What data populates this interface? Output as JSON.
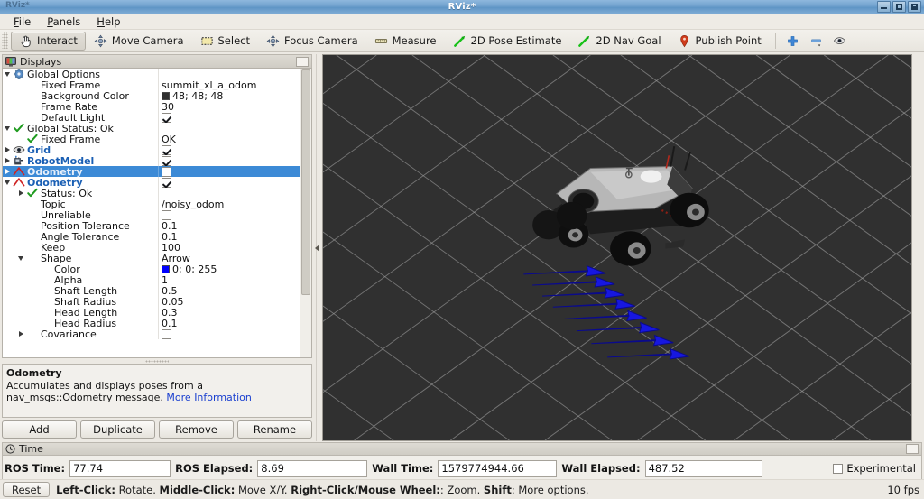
{
  "window": {
    "title": "RViz*",
    "controls": [
      "minimize",
      "maximize",
      "close"
    ]
  },
  "menubar": {
    "items": [
      {
        "label": "File",
        "mnemonic": "F"
      },
      {
        "label": "Panels",
        "mnemonic": "P"
      },
      {
        "label": "Help",
        "mnemonic": "H"
      }
    ]
  },
  "toolbar": {
    "tools": [
      {
        "label": "Interact",
        "icon": "hand-cursor-icon",
        "active": true
      },
      {
        "label": "Move Camera",
        "icon": "move-camera-icon",
        "active": false
      },
      {
        "label": "Select",
        "icon": "select-rect-icon",
        "active": false
      },
      {
        "label": "Focus Camera",
        "icon": "focus-camera-icon",
        "active": false
      },
      {
        "label": "Measure",
        "icon": "measure-icon",
        "active": false
      },
      {
        "label": "2D Pose Estimate",
        "icon": "pose-arrow-icon",
        "active": false
      },
      {
        "label": "2D Nav Goal",
        "icon": "nav-goal-arrow-icon",
        "active": false
      },
      {
        "label": "Publish Point",
        "icon": "map-pin-icon",
        "active": false
      }
    ],
    "right_buttons": [
      {
        "icon": "plus-icon",
        "label": "+"
      },
      {
        "icon": "minus-icon",
        "label": "−"
      },
      {
        "icon": "eye-icon",
        "label": "eye"
      }
    ]
  },
  "displays_panel": {
    "title": "Displays",
    "title_icon": "monitor-icon",
    "float_button": "undock-button",
    "rows": [
      {
        "indent": 0,
        "expander": "open",
        "icon": "gear-icon",
        "label": "Global Options",
        "style": "plain",
        "value_type": "none"
      },
      {
        "indent": 1,
        "expander": "none",
        "icon": "none",
        "label": "Fixed Frame",
        "style": "plain",
        "value_type": "text",
        "value": "summit_xl_a_odom"
      },
      {
        "indent": 1,
        "expander": "none",
        "icon": "none",
        "label": "Background Color",
        "style": "plain",
        "value_type": "color",
        "value": "48; 48; 48",
        "color": "#303030"
      },
      {
        "indent": 1,
        "expander": "none",
        "icon": "none",
        "label": "Frame Rate",
        "style": "plain",
        "value_type": "text",
        "value": "30"
      },
      {
        "indent": 1,
        "expander": "none",
        "icon": "none",
        "label": "Default Light",
        "style": "plain",
        "value_type": "checkbox",
        "checked": true
      },
      {
        "indent": 0,
        "expander": "open",
        "icon": "check-icon",
        "label": "Global Status: Ok",
        "style": "plain",
        "value_type": "none"
      },
      {
        "indent": 1,
        "expander": "none",
        "icon": "check-icon",
        "label": "Fixed Frame",
        "style": "plain",
        "value_type": "text",
        "value": "OK"
      },
      {
        "indent": 0,
        "expander": "closed",
        "icon": "eye-icon",
        "label": "Grid",
        "style": "blue",
        "value_type": "checkbox",
        "checked": true
      },
      {
        "indent": 0,
        "expander": "closed",
        "icon": "robot-icon",
        "label": "RobotModel",
        "style": "blue",
        "value_type": "checkbox",
        "checked": true
      },
      {
        "indent": 0,
        "expander": "closed",
        "icon": "odometry-icon",
        "label": "Odometry",
        "style": "blue",
        "value_type": "checkbox",
        "checked": false,
        "selected": true
      },
      {
        "indent": 0,
        "expander": "open",
        "icon": "odometry-icon",
        "label": "Odometry",
        "style": "blue",
        "value_type": "checkbox",
        "checked": true
      },
      {
        "indent": 1,
        "expander": "closed",
        "icon": "check-icon",
        "label": "Status: Ok",
        "style": "plain",
        "value_type": "none"
      },
      {
        "indent": 1,
        "expander": "none",
        "icon": "none",
        "label": "Topic",
        "style": "plain",
        "value_type": "text",
        "value": "/noisy_odom"
      },
      {
        "indent": 1,
        "expander": "none",
        "icon": "none",
        "label": "Unreliable",
        "style": "plain",
        "value_type": "checkbox",
        "checked": false
      },
      {
        "indent": 1,
        "expander": "none",
        "icon": "none",
        "label": "Position Tolerance",
        "style": "plain",
        "value_type": "text",
        "value": "0.1"
      },
      {
        "indent": 1,
        "expander": "none",
        "icon": "none",
        "label": "Angle Tolerance",
        "style": "plain",
        "value_type": "text",
        "value": "0.1"
      },
      {
        "indent": 1,
        "expander": "none",
        "icon": "none",
        "label": "Keep",
        "style": "plain",
        "value_type": "text",
        "value": "100"
      },
      {
        "indent": 1,
        "expander": "open",
        "icon": "none",
        "label": "Shape",
        "style": "plain",
        "value_type": "text",
        "value": "Arrow"
      },
      {
        "indent": 2,
        "expander": "none",
        "icon": "none",
        "label": "Color",
        "style": "plain",
        "value_type": "color",
        "value": "0; 0; 255",
        "color": "#0000ff"
      },
      {
        "indent": 2,
        "expander": "none",
        "icon": "none",
        "label": "Alpha",
        "style": "plain",
        "value_type": "text",
        "value": "1"
      },
      {
        "indent": 2,
        "expander": "none",
        "icon": "none",
        "label": "Shaft Length",
        "style": "plain",
        "value_type": "text",
        "value": "0.5"
      },
      {
        "indent": 2,
        "expander": "none",
        "icon": "none",
        "label": "Shaft Radius",
        "style": "plain",
        "value_type": "text",
        "value": "0.05"
      },
      {
        "indent": 2,
        "expander": "none",
        "icon": "none",
        "label": "Head Length",
        "style": "plain",
        "value_type": "text",
        "value": "0.3"
      },
      {
        "indent": 2,
        "expander": "none",
        "icon": "none",
        "label": "Head Radius",
        "style": "plain",
        "value_type": "text",
        "value": "0.1"
      },
      {
        "indent": 1,
        "expander": "closed",
        "icon": "none",
        "label": "Covariance",
        "style": "plain",
        "value_type": "checkbox",
        "checked": false
      }
    ]
  },
  "description": {
    "title": "Odometry",
    "text_line1": "Accumulates and displays poses from a",
    "text_line2": "nav_msgs::Odometry message.",
    "link": "More Information"
  },
  "display_buttons": [
    {
      "label": "Add"
    },
    {
      "label": "Duplicate"
    },
    {
      "label": "Remove"
    },
    {
      "label": "Rename"
    }
  ],
  "viewport": {
    "background_color": "#303030",
    "grid_color": "#9d9d9d",
    "collapse_arrow": "collapse-left-arrow",
    "robot": {
      "name": "summit_xl",
      "body_color": "#b9b9b9",
      "body_dark_color": "#2a2a2a",
      "wheel_color": "#141414",
      "arrow_color": "#1717e0",
      "arrow_count": 8
    }
  },
  "time_panel": {
    "title": "Time",
    "title_icon": "clock-icon",
    "float_button": "undock-button",
    "fields": [
      {
        "label": "ROS Time:",
        "value": "77.74"
      },
      {
        "label": "ROS Elapsed:",
        "value": "8.69"
      },
      {
        "label": "Wall Time:",
        "value": "1579774944.66"
      },
      {
        "label": "Wall Elapsed:",
        "value": "487.52"
      }
    ],
    "experimental": {
      "label": "Experimental",
      "checked": false
    }
  },
  "statusbar": {
    "reset_label": "Reset",
    "hint_parts": [
      {
        "text": "Left-Click:",
        "bold": true
      },
      {
        "text": " Rotate. ",
        "bold": false
      },
      {
        "text": "Middle-Click:",
        "bold": true
      },
      {
        "text": " Move X/Y. ",
        "bold": false
      },
      {
        "text": "Right-Click/Mouse Wheel:",
        "bold": true
      },
      {
        "text": ": Zoom. ",
        "bold": false
      },
      {
        "text": "Shift",
        "bold": true
      },
      {
        "text": ": More options.",
        "bold": false
      }
    ],
    "hint_text": "Left-Click: Rotate. Middle-Click: Move X/Y. Right-Click/Mouse Wheel:: Zoom. Shift: More options.",
    "fps": "10 fps"
  }
}
